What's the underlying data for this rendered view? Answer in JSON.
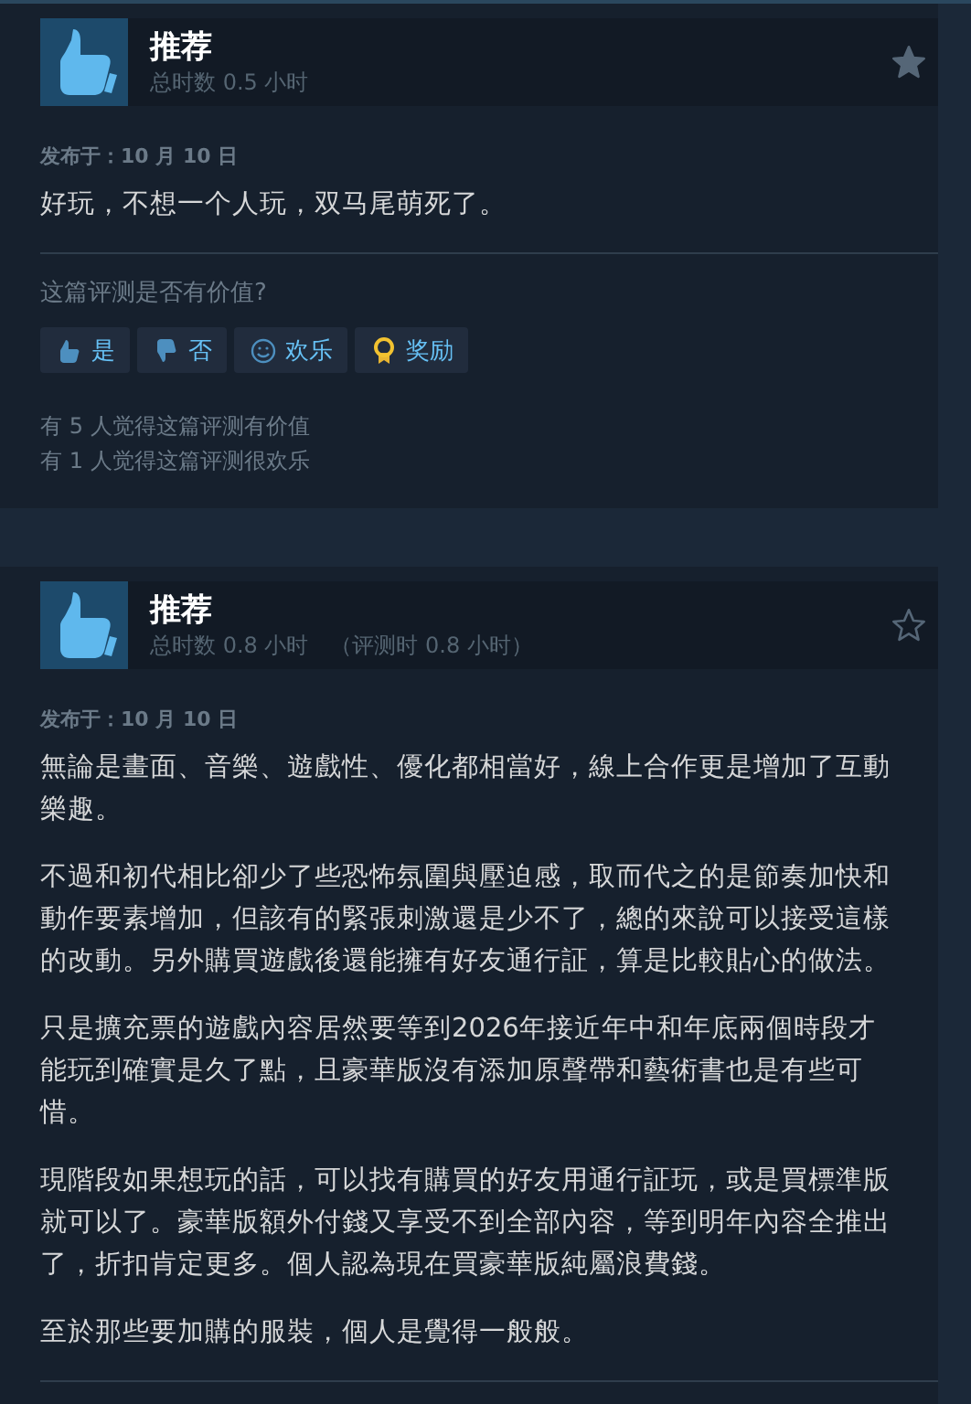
{
  "reviews": [
    {
      "verdict": "推荐",
      "recommended": true,
      "hours": "总时数 0.5 小时",
      "starred": true,
      "posted": "发布于：10 月 10 日",
      "paragraphs": [
        "好玩，不想一个人玩，双马尾萌死了。"
      ],
      "helpful_prompt": "这篇评测是否有价值?",
      "buttons": [
        {
          "kind": "yes",
          "label": "是"
        },
        {
          "kind": "no",
          "label": "否"
        },
        {
          "kind": "funny",
          "label": "欢乐"
        },
        {
          "kind": "award",
          "label": "奖励"
        }
      ],
      "stats": [
        "有 5 人觉得这篇评测有价值",
        "有 1 人觉得这篇评测很欢乐"
      ]
    },
    {
      "verdict": "推荐",
      "recommended": true,
      "hours": "总时数 0.8 小时",
      "hours_at_review": "（评测时 0.8 小时）",
      "starred": false,
      "posted": "发布于：10 月 10 日",
      "paragraphs": [
        "無論是畫面、音樂、遊戲性、優化都相當好，線上合作更是增加了互動樂趣。",
        "不過和初代相比卻少了些恐怖氛圍與壓迫感，取而代之的是節奏加快和動作要素增加，但該有的緊張刺激還是少不了，總的來說可以接受這樣的改動。另外購買遊戲後還能擁有好友通行証，算是比較貼心的做法。",
        "只是擴充票的遊戲內容居然要等到2026年接近年中和年底兩個時段才能玩到確實是久了點，且豪華版沒有添加原聲帶和藝術書也是有些可惜。",
        "現階段如果想玩的話，可以找有購買的好友用通行証玩，或是買標準版就可以了。豪華版額外付錢又享受不到全部內容，等到明年內容全推出了，折扣肯定更多。個人認為現在買豪華版純屬浪費錢。",
        "至於那些要加購的服裝，個人是覺得一般般。"
      ]
    }
  ]
}
